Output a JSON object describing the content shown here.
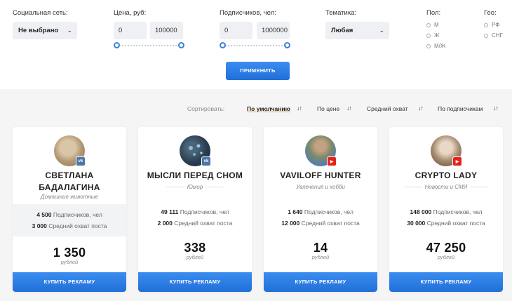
{
  "filters": {
    "social": {
      "label": "Социальная сеть:",
      "value": "Не выбрано"
    },
    "price": {
      "label": "Цена, руб:",
      "min": "0",
      "max": "100000"
    },
    "subs": {
      "label": "Подписчиков, чел:",
      "min": "0",
      "max": "1000000"
    },
    "topic": {
      "label": "Тематика:",
      "value": "Любая"
    },
    "gender": {
      "label": "Пол:",
      "options": [
        "М",
        "Ж",
        "М/Ж"
      ]
    },
    "geo": {
      "label": "Гео:",
      "options": [
        "РФ",
        "СНГ"
      ]
    },
    "apply_label": "ПРИМЕНИТЬ"
  },
  "sort": {
    "label": "Сортировать:",
    "options": [
      "По умолчанию",
      "По цене",
      "Средний охват",
      "По подписчикам"
    ],
    "active": "По умолчанию"
  },
  "cards": [
    {
      "name_line1": "СВЕТЛАНА",
      "name_line2": "БАДАЛАГИНА",
      "topic": "Домашние животные",
      "network": "vk",
      "subs_value": "4 500",
      "subs_label": "Подписчиков, чел",
      "reach_value": "3 000",
      "reach_label": "Средний охват поста",
      "price": "1 350",
      "currency": "рублей",
      "buy_label": "КУПИТЬ РЕКЛАМУ"
    },
    {
      "name_line1": "МЫСЛИ ПЕРЕД СНОМ",
      "name_line2": "",
      "topic": "Юмор",
      "network": "vk",
      "subs_value": "49 111",
      "subs_label": "Подписчиков, чел",
      "reach_value": "2 000",
      "reach_label": "Средний охват поста",
      "price": "338",
      "currency": "рублей",
      "buy_label": "КУПИТЬ РЕКЛАМУ"
    },
    {
      "name_line1": "VAVILOFF HUNTER",
      "name_line2": "",
      "topic": "Увлечения и хобби",
      "network": "youtube",
      "subs_value": "1 640",
      "subs_label": "Подписчиков, чел",
      "reach_value": "12 000",
      "reach_label": "Средний охват поста",
      "price": "14",
      "currency": "рублей",
      "buy_label": "КУПИТЬ РЕКЛАМУ"
    },
    {
      "name_line1": "CRYPTO LADY",
      "name_line2": "",
      "topic": "Новости и СМИ",
      "network": "youtube",
      "subs_value": "148 000",
      "subs_label": "Подписчиков, чел",
      "reach_value": "30 000",
      "reach_label": "Средний охват поста",
      "price": "47 250",
      "currency": "рублей",
      "buy_label": "КУПИТЬ РЕКЛАМУ"
    }
  ],
  "colors": {
    "accent": "#2a7ae4",
    "sort_underline": "#e7a34a",
    "vk": "#4a76a8",
    "youtube": "#e62117"
  }
}
